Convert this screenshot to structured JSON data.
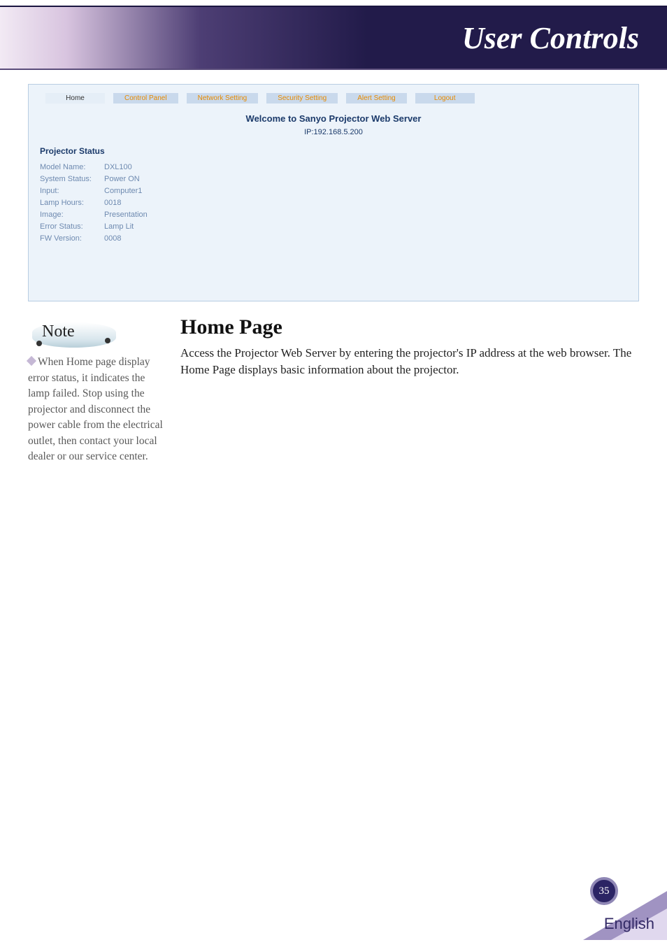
{
  "header": {
    "title": "User Controls"
  },
  "screenshot": {
    "tabs": [
      {
        "label": "Home",
        "active": true
      },
      {
        "label": "Control Panel",
        "active": false
      },
      {
        "label": "Network Setting",
        "active": false
      },
      {
        "label": "Security Setting",
        "active": false
      },
      {
        "label": "Alert Setting",
        "active": false
      },
      {
        "label": "Logout",
        "active": false
      }
    ],
    "welcome": "Welcome to Sanyo Projector Web Server",
    "ip": "IP:192.168.5.200",
    "section_title": "Projector Status",
    "status": [
      {
        "label": "Model Name:",
        "value": "DXL100"
      },
      {
        "label": "System Status:",
        "value": "Power ON"
      },
      {
        "label": "Input:",
        "value": "Computer1"
      },
      {
        "label": "Lamp Hours:",
        "value": "0018"
      },
      {
        "label": "Image:",
        "value": "Presentation"
      },
      {
        "label": "Error Status:",
        "value": "Lamp Lit"
      },
      {
        "label": "FW Version:",
        "value": "0008"
      }
    ]
  },
  "note": {
    "heading": "Note",
    "text": "When Home page display error status, it indicates the lamp failed. Stop using the projector and disconnect the power cable from the electrical outlet, then contact your local dealer or our service center."
  },
  "main": {
    "heading": "Home Page",
    "paragraph": "Access the Projector Web Server by entering the projector's IP address at the web browser. The Home Page displays basic information about the projector."
  },
  "footer": {
    "page": "35",
    "language": "English"
  }
}
